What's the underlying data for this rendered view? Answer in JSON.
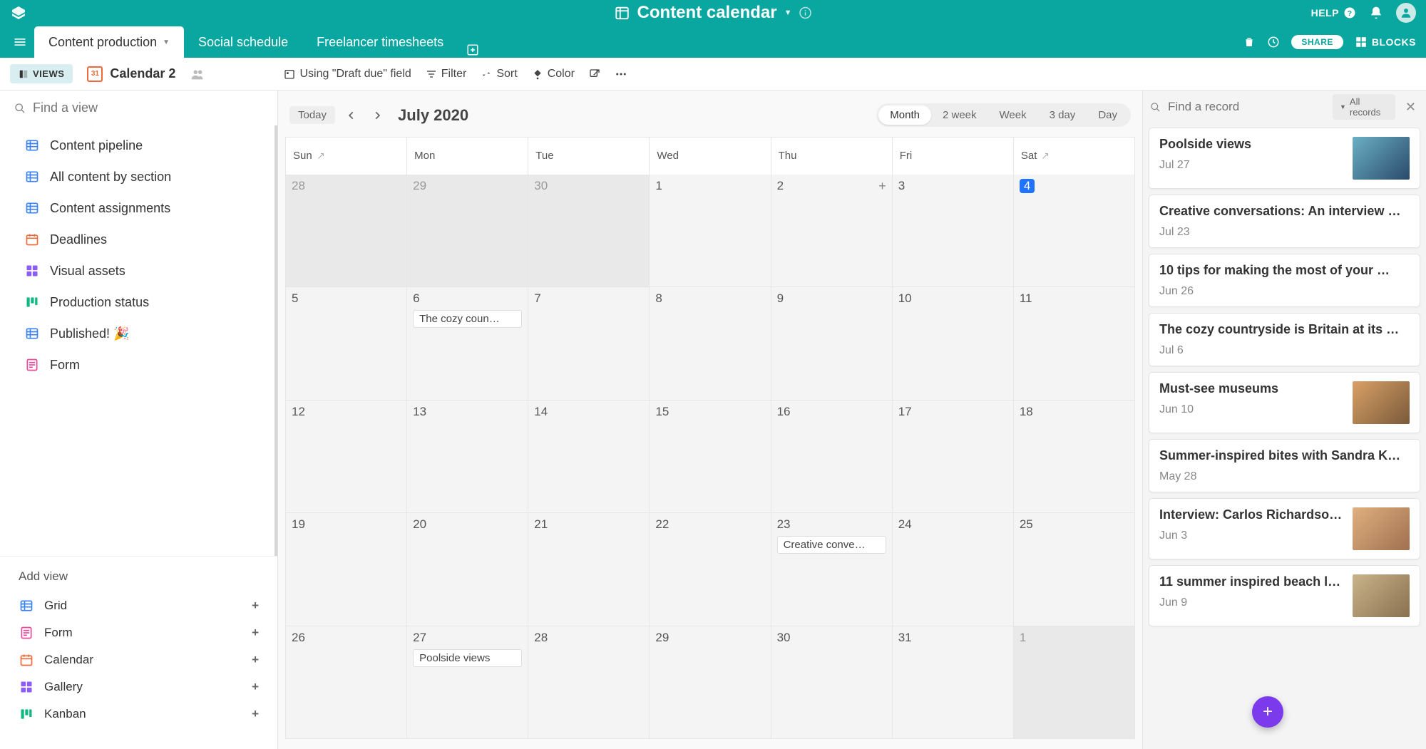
{
  "header": {
    "title": "Content calendar",
    "help_label": "HELP"
  },
  "tabs": {
    "items": [
      {
        "label": "Content production",
        "active": true
      },
      {
        "label": "Social schedule",
        "active": false
      },
      {
        "label": "Freelancer timesheets",
        "active": false
      }
    ],
    "share_label": "SHARE",
    "blocks_label": "BLOCKS"
  },
  "toolbar": {
    "views_label": "VIEWS",
    "view_name": "Calendar 2",
    "using_field": "Using \"Draft due\" field",
    "filter": "Filter",
    "sort": "Sort",
    "color": "Color"
  },
  "sidebar": {
    "find_placeholder": "Find a view",
    "views": [
      {
        "label": "Content pipeline",
        "icon": "grid"
      },
      {
        "label": "All content by section",
        "icon": "grid"
      },
      {
        "label": "Content assignments",
        "icon": "grid"
      },
      {
        "label": "Deadlines",
        "icon": "calendar"
      },
      {
        "label": "Visual assets",
        "icon": "gallery"
      },
      {
        "label": "Production status",
        "icon": "kanban"
      },
      {
        "label": "Published! 🎉",
        "icon": "grid"
      },
      {
        "label": "Form",
        "icon": "form"
      }
    ],
    "add_view_title": "Add view",
    "add_view_types": [
      {
        "label": "Grid",
        "icon": "grid"
      },
      {
        "label": "Form",
        "icon": "form"
      },
      {
        "label": "Calendar",
        "icon": "calendar"
      },
      {
        "label": "Gallery",
        "icon": "gallery"
      },
      {
        "label": "Kanban",
        "icon": "kanban"
      }
    ]
  },
  "calendar": {
    "today_label": "Today",
    "month_label": "July 2020",
    "ranges": [
      "Month",
      "2 week",
      "Week",
      "3 day",
      "Day"
    ],
    "range_active": "Month",
    "day_headers": [
      "Sun",
      "Mon",
      "Tue",
      "Wed",
      "Thu",
      "Fri",
      "Sat"
    ],
    "weeks": [
      [
        {
          "n": "28",
          "out": true
        },
        {
          "n": "29",
          "out": true
        },
        {
          "n": "30",
          "out": true
        },
        {
          "n": "1"
        },
        {
          "n": "2",
          "addplus": true
        },
        {
          "n": "3"
        },
        {
          "n": "4",
          "today": true
        }
      ],
      [
        {
          "n": "5"
        },
        {
          "n": "6",
          "events": [
            "The cozy coun…"
          ]
        },
        {
          "n": "7"
        },
        {
          "n": "8"
        },
        {
          "n": "9"
        },
        {
          "n": "10"
        },
        {
          "n": "11"
        }
      ],
      [
        {
          "n": "12"
        },
        {
          "n": "13"
        },
        {
          "n": "14"
        },
        {
          "n": "15"
        },
        {
          "n": "16"
        },
        {
          "n": "17"
        },
        {
          "n": "18"
        }
      ],
      [
        {
          "n": "19"
        },
        {
          "n": "20"
        },
        {
          "n": "21"
        },
        {
          "n": "22"
        },
        {
          "n": "23",
          "events": [
            "Creative conve…"
          ]
        },
        {
          "n": "24"
        },
        {
          "n": "25"
        }
      ],
      [
        {
          "n": "26"
        },
        {
          "n": "27",
          "events": [
            "Poolside views"
          ]
        },
        {
          "n": "28"
        },
        {
          "n": "29"
        },
        {
          "n": "30"
        },
        {
          "n": "31"
        },
        {
          "n": "1",
          "out": true
        }
      ]
    ]
  },
  "records": {
    "find_placeholder": "Find a record",
    "all_records_label": "All records",
    "items": [
      {
        "title": "Poolside views",
        "date": "Jul 27",
        "thumb": "t1"
      },
      {
        "title": "Creative conversations: An interview …",
        "date": "Jul 23"
      },
      {
        "title": "10 tips for making the most of your …",
        "date": "Jun 26"
      },
      {
        "title": "The cozy countryside is Britain at its …",
        "date": "Jul 6"
      },
      {
        "title": "Must-see museums",
        "date": "Jun 10",
        "thumb": "t2"
      },
      {
        "title": "Summer-inspired bites with Sandra K…",
        "date": "May 28"
      },
      {
        "title": "Interview: Carlos Richardso…",
        "date": "Jun 3",
        "thumb": "t3"
      },
      {
        "title": "11 summer inspired beach l…",
        "date": "Jun 9",
        "thumb": "t4"
      }
    ]
  }
}
